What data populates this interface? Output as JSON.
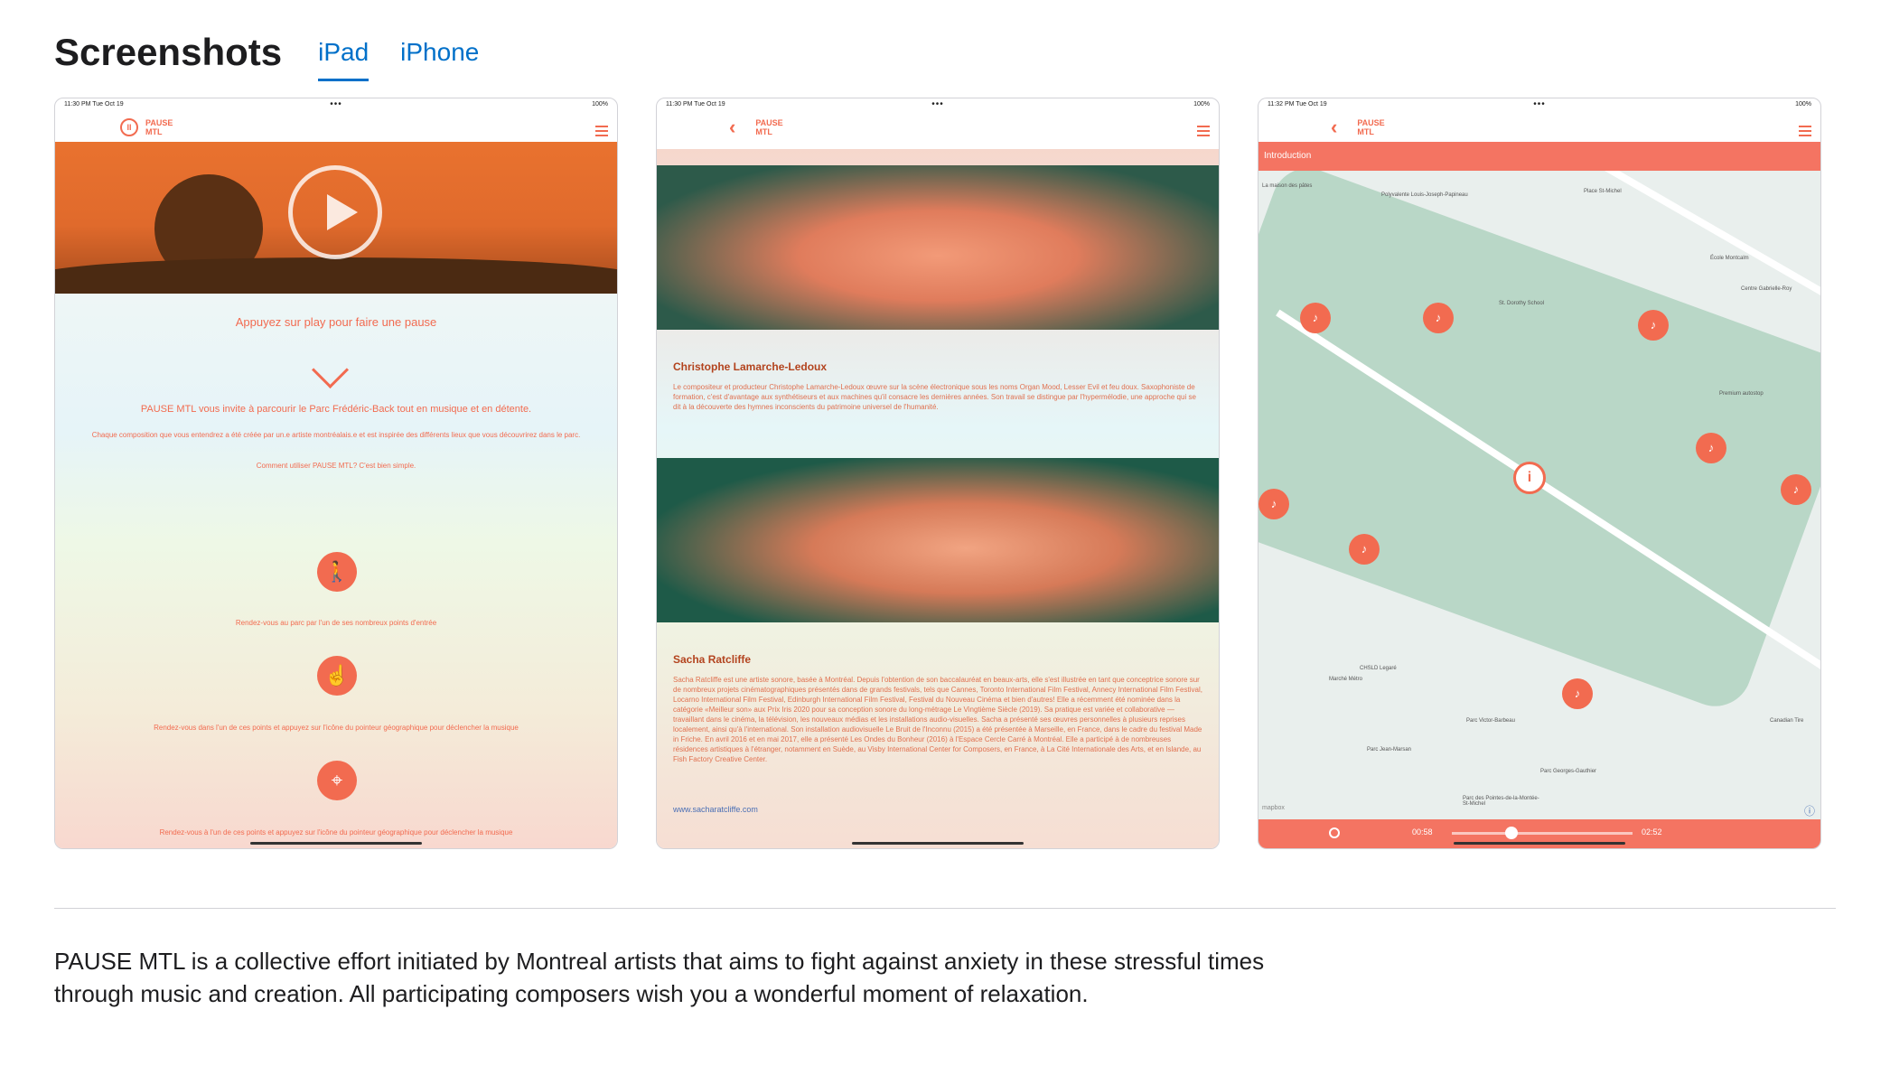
{
  "header": {
    "title": "Screenshots",
    "tabs": [
      {
        "label": "iPad",
        "active": true
      },
      {
        "label": "iPhone",
        "active": false
      }
    ]
  },
  "screens": [
    {
      "status_left": "11:30 PM   Tue Oct 19",
      "status_right": "100%",
      "logo_text_1": "PAUSE",
      "logo_text_2": "MTL",
      "tagline": "Appuyez sur play pour faire une pause",
      "invite": "PAUSE MTL vous invite à parcourir le Parc Frédéric-Back tout en musique et en détente.",
      "composition": "Chaque composition que vous entendrez a été créée par un.e artiste montréalais.e et est inspirée des différents lieux que vous découvrirez dans le parc.",
      "howto": "Comment utiliser PAUSE MTL? C'est bien simple.",
      "step1": "Rendez-vous au parc par l'un de ses nombreux points d'entrée",
      "step2": "Rendez-vous dans l'un de ces points et appuyez sur l'icône du pointeur géographique pour déclencher la musique",
      "step3": "Rendez-vous à l'un de ces points et appuyez sur l'icône du pointeur géographique pour déclencher la musique"
    },
    {
      "status_left": "11:30 PM   Tue Oct 19",
      "status_right": "100%",
      "logo_text_1": "PAUSE",
      "logo_text_2": "MTL",
      "artist1_name": "Christophe Lamarche-Ledoux",
      "artist1_bio": "Le compositeur et producteur Christophe Lamarche-Ledoux œuvre sur la scène électronique sous les noms Organ Mood, Lesser Evil et feu doux. Saxophoniste de formation, c'est d'avantage aux synthétiseurs et aux machines qu'il consacre les dernières années. Son travail se distingue par l'hypermélodie, une approche qui se dit à la découverte des hymnes inconscients du patrimoine universel de l'humanité.",
      "artist2_name": "Sacha Ratcliffe",
      "artist2_bio": "Sacha Ratcliffe est une artiste sonore, basée à Montréal. Depuis l'obtention de son baccalauréat en beaux-arts, elle s'est illustrée en tant que conceptrice sonore sur de nombreux projets cinématographiques présentés dans de grands festivals, tels que Cannes, Toronto International Film Festival, Annecy International Film Festival, Locarno International Film Festival, Edinburgh International Film Festival, Festival du Nouveau Cinéma et bien d'autres! Elle a récemment été nominée dans la catégorie «Meilleur son» aux Prix Iris 2020 pour sa conception sonore du long-métrage Le Vingtième Siècle (2019). Sa pratique est variée et collaborative — travaillant dans le cinéma, la télévision, les nouveaux médias et les installations audio-visuelles. Sacha a présenté ses œuvres personnelles à plusieurs reprises localement, ainsi qu'à l'international. Son installation audiovisuelle Le Bruit de l'Inconnu (2015) a été présentée à Marseille, en France, dans le cadre du festival Made in Friche. En avril 2016 et en mai 2017, elle a présenté Les Ondes du Bonheur (2016) à l'Espace Cercle Carré à Montréal. Elle a participé à de nombreuses résidences artistiques à l'étranger, notamment en Suède, au Visby International Center for Composers, en France, à La Cité Internationale des Arts, et en Islande, au Fish Factory Creative Center.",
      "link": "www.sacharatcliffe.com"
    },
    {
      "status_left": "11:32 PM   Tue Oct 19",
      "status_right": "100%",
      "logo_text_1": "PAUSE",
      "logo_text_2": "MTL",
      "intro": "Introduction",
      "time_elapsed": "00:58",
      "time_total": "02:52",
      "progress": 0.33,
      "map_labels": [
        "La maison des pâtes",
        "Polyvalente Louis-Joseph-Papineau",
        "Place St-Michel",
        "École Montcalm",
        "Centre Gabrielle-Roy",
        "St. Dorothy School",
        "Premium autostop",
        "CHSLD Legaré",
        "Marché Métro",
        "Parc Victor-Barbeau",
        "Parc Jean-Marsan",
        "Parc Georges-Gauthier",
        "Parc des Pointes-de-la-Montée-St-Michel",
        "Canadian Tire"
      ],
      "map_attribution": "mapbox"
    }
  ],
  "description": "PAUSE MTL is a collective effort initiated by Montreal artists that aims to fight against anxiety in these stressful times through music and creation. All participating composers wish you a wonderful moment of relaxation."
}
